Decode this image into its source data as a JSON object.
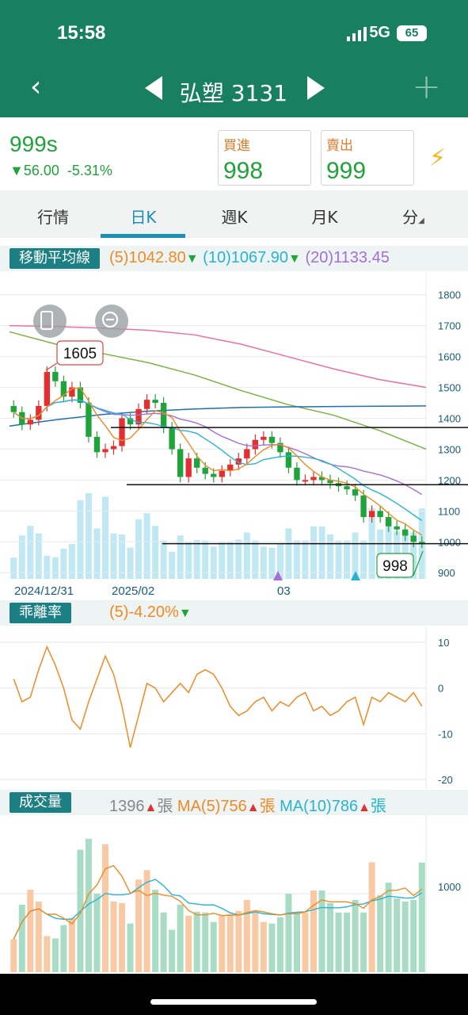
{
  "status_bar": {
    "time": "15:58",
    "network": "5G",
    "battery": "65"
  },
  "nav": {
    "title": "弘塑 3131"
  },
  "quote": {
    "price": "999s",
    "change": "56.00",
    "change_pct": "-5.31%",
    "buy_label": "買進",
    "buy_value": "998",
    "sell_label": "賣出",
    "sell_value": "999"
  },
  "tabs": [
    "行情",
    "日K",
    "週K",
    "月K",
    "分"
  ],
  "active_tab": "日K",
  "ma_indicator": {
    "label": "移動平均線",
    "ma5": "(5)1042.80",
    "ma10": "(10)1067.90",
    "ma20": "(20)1133.45"
  },
  "price_chart": {
    "y_ticks": [
      "1800",
      "1700",
      "1600",
      "1500",
      "1400",
      "1300",
      "1200",
      "1100",
      "1000",
      "900"
    ],
    "x_labels": [
      "2024/12/31",
      "2025/02",
      "03"
    ],
    "high_callout": "1605",
    "current_callout": "998"
  },
  "bias_indicator": {
    "label": "乖離率",
    "value": "(5)-4.20%",
    "y_ticks": [
      "10",
      "0",
      "-10",
      "-20"
    ]
  },
  "volume_indicator": {
    "label": "成交量",
    "volume": "1396",
    "unit": "張",
    "ma5": "MA(5)756",
    "ma10": "MA(10)786",
    "y_tick": "1000"
  },
  "colors": {
    "header": "#187f5f",
    "down": "#1fa33b",
    "up": "#e23030",
    "ma5": "#f08a24",
    "ma10": "#27b4d4",
    "ma20": "#a46fd6",
    "ma60": "#7cb342",
    "ma120": "#1f6fb2",
    "ma240": "#ef6fa0"
  },
  "chart_data": [
    {
      "type": "candlestick",
      "title": "",
      "ylim": [
        880,
        1830
      ],
      "y_ticks": [
        1800,
        1700,
        1600,
        1500,
        1400,
        1300,
        1200,
        1100,
        1000,
        900
      ],
      "x_labels": [
        "2024/12/31",
        "2025/02",
        "03"
      ],
      "series_close": [
        1420,
        1380,
        1395,
        1440,
        1550,
        1520,
        1470,
        1500,
        1450,
        1340,
        1290,
        1300,
        1310,
        1400,
        1380,
        1430,
        1460,
        1450,
        1370,
        1300,
        1210,
        1270,
        1240,
        1220,
        1210,
        1230,
        1250,
        1270,
        1300,
        1330,
        1340,
        1320,
        1290,
        1240,
        1200,
        1200,
        1210,
        1200,
        1190,
        1180,
        1170,
        1150,
        1080,
        1100,
        1080,
        1050,
        1040,
        1020,
        1000,
        998
      ],
      "horizontal_lines": [
        1370,
        1185,
        994
      ]
    },
    {
      "type": "line",
      "title": "乖離率",
      "ylim": [
        -20,
        10
      ],
      "y_ticks": [
        10,
        0,
        -10,
        -20
      ],
      "values": [
        2,
        -3,
        -2,
        4,
        9,
        5,
        0,
        -7,
        -9,
        -3,
        2,
        7,
        3,
        -4,
        -13,
        -6,
        1,
        0,
        -3,
        -1,
        1,
        -1,
        3,
        4,
        3,
        0,
        -4,
        -6,
        -5,
        -3,
        -2,
        -5,
        -3,
        -4,
        -2,
        -1,
        -5,
        -4,
        -6,
        -5,
        -3,
        -2,
        -8,
        -2,
        -3,
        -1,
        -2,
        -3,
        -1,
        -4
      ]
    },
    {
      "type": "bar",
      "title": "成交量",
      "y_ticks": [
        1000
      ],
      "values": [
        420,
        860,
        1050,
        900,
        460,
        430,
        600,
        690,
        1560,
        1700,
        1000,
        1630,
        900,
        880,
        620,
        1180,
        1300,
        1050,
        760,
        540,
        860,
        720,
        770,
        760,
        640,
        720,
        740,
        780,
        920,
        760,
        640,
        620,
        700,
        1000,
        760,
        760,
        1040,
        1040,
        880,
        760,
        760,
        920,
        760,
        1400,
        980,
        1140,
        940,
        900,
        920,
        1396
      ]
    }
  ]
}
